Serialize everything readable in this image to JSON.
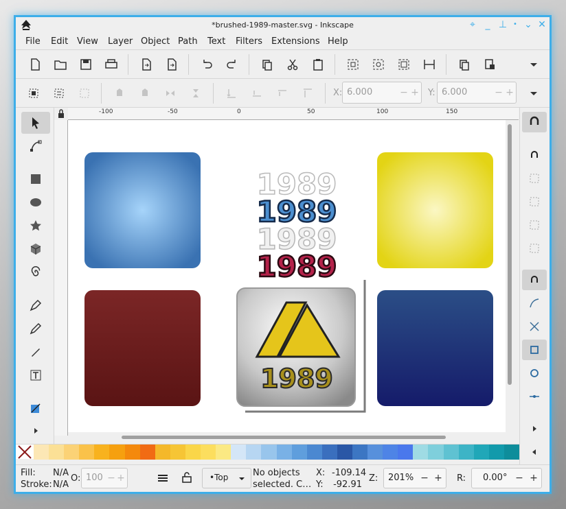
{
  "window": {
    "title": "*brushed-1989-master.svg - Inkscape"
  },
  "menu": [
    "File",
    "Edit",
    "View",
    "Layer",
    "Object",
    "Path",
    "Text",
    "Filters",
    "Extensions",
    "Help"
  ],
  "toolbar2": {
    "x_label": "X:",
    "x_value": "6.000",
    "y_label": "Y:",
    "y_value": "6.000",
    "minus": "−",
    "plus": "+"
  },
  "ruler": {
    "top_labels": [
      "-100",
      "-50",
      "0",
      "50",
      "100",
      "150"
    ]
  },
  "canvas": {
    "text_1989": "1989"
  },
  "status": {
    "fill_label": "Fill:",
    "fill_value": "N/A",
    "stroke_label": "Stroke:",
    "stroke_value": "N/A",
    "opacity_label": "O:",
    "opacity_value": "100",
    "layer": "•Top",
    "message_line1": "No objects",
    "message_line2": "selected. C…",
    "x_label": "X:",
    "x_value": "-109.14",
    "y_label": "Y:",
    "y_value": "-92.91",
    "zoom_label": "Z:",
    "zoom_value": "201%",
    "rotate_label": "R:",
    "rotate_value": "0.00°"
  },
  "colors": {
    "accent": "#3daee9",
    "card_blue": "#3a7cc0",
    "card_yellow": "#e8dc1e",
    "card_red": "#6e1d1d",
    "card_navy": "#1e2b6e"
  },
  "palette": [
    "#fce7b5",
    "#fbe096",
    "#fbd276",
    "#fac24a",
    "#f8b21e",
    "#f6a00f",
    "#f4890c",
    "#f16b14",
    "#f4b82a",
    "#f6c535",
    "#fad649",
    "#fcde5e",
    "#fbe983",
    "#d4e6f7",
    "#b7d6f2",
    "#98c5ec",
    "#79b1e6",
    "#5f9edd",
    "#4b88d1",
    "#3a6fbe",
    "#2a57a6",
    "#3c76c3",
    "#5790dc",
    "#4e84e6",
    "#4a78ec",
    "#9fdbe4",
    "#7fcfdc",
    "#5fc2d2",
    "#3db4c6",
    "#20a7b8",
    "#129aab",
    "#0e8d9b"
  ]
}
